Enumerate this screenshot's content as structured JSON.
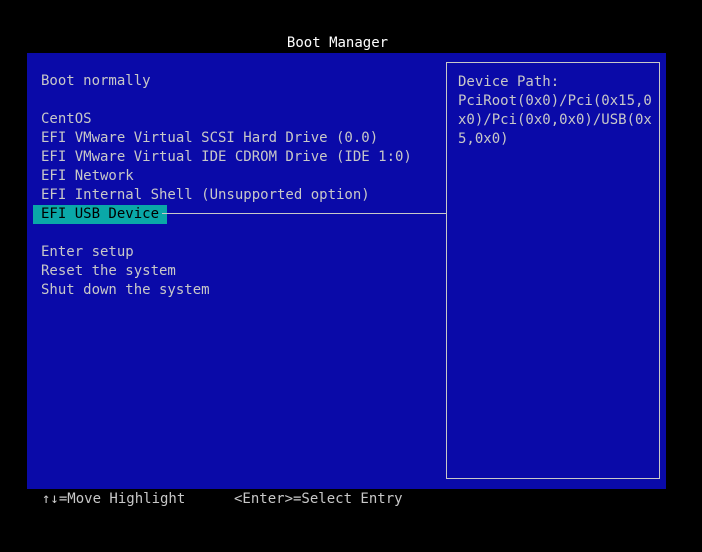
{
  "title": "Boot Manager",
  "menu": {
    "group1": [
      {
        "label": "Boot normally"
      }
    ],
    "group2": [
      {
        "label": "CentOS"
      },
      {
        "label": "EFI VMware Virtual SCSI Hard Drive (0.0)"
      },
      {
        "label": "EFI VMware Virtual IDE CDROM Drive (IDE 1:0)"
      },
      {
        "label": "EFI Network"
      },
      {
        "label": "EFI Internal Shell (Unsupported option)"
      },
      {
        "label": "EFI USB Device",
        "selected": true
      }
    ],
    "group3": [
      {
        "label": "Enter setup"
      },
      {
        "label": "Reset the system"
      },
      {
        "label": "Shut down the system"
      }
    ]
  },
  "info": {
    "label": "Device Path:",
    "value": "PciRoot(0x0)/Pci(0x15,0x0)/Pci(0x0,0x0)/USB(0x5,0x0)"
  },
  "footer": {
    "move_hint": "↑↓=Move Highlight",
    "select_hint": "<Enter>=Select Entry"
  },
  "colors": {
    "background": "#000000",
    "frame": "#0a0aa8",
    "text": "#c8c8c8",
    "highlight_bg": "#0aa8a8",
    "highlight_text": "#000000",
    "title": "#ffffff"
  }
}
